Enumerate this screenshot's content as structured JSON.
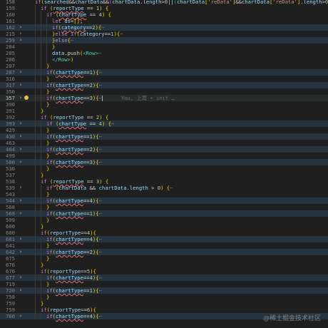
{
  "editor": {
    "lines": [
      {
        "n": "158",
        "fold": "",
        "hl": false,
        "cur": false,
        "bulb": false,
        "indent": 0,
        "code": "if(searched&&chartData&&(chartData.length>0||(chartData['reData']&&chartData['reData'].length>0))){"
      },
      {
        "n": "159",
        "fold": "",
        "hl": false,
        "cur": false,
        "bulb": false,
        "indent": 1,
        "code": "if (reportType == 1) {"
      },
      {
        "n": "160",
        "fold": "",
        "hl": false,
        "cur": false,
        "bulb": false,
        "indent": 2,
        "code": "if (chartType == 4) {"
      },
      {
        "n": "161",
        "fold": "",
        "hl": false,
        "cur": false,
        "bulb": false,
        "indent": 3,
        "code": "let ds=[];"
      },
      {
        "n": "162",
        "fold": "›",
        "hl": true,
        "cur": false,
        "bulb": false,
        "indent": 3,
        "code": "if(category==2){⋯"
      },
      {
        "n": "215",
        "fold": "›",
        "hl": false,
        "cur": false,
        "bulb": false,
        "indent": 3,
        "code": "}else if(category==1){⋯"
      },
      {
        "n": "259",
        "fold": "›",
        "hl": true,
        "cur": false,
        "bulb": false,
        "indent": 3,
        "code": "}else{⋯"
      },
      {
        "n": "284",
        "fold": "",
        "hl": false,
        "cur": false,
        "bulb": false,
        "indent": 3,
        "code": "}"
      },
      {
        "n": "285",
        "fold": "",
        "hl": false,
        "cur": false,
        "bulb": false,
        "indent": 3,
        "code": "data.push(<Row>⋯"
      },
      {
        "n": "286",
        "fold": "",
        "hl": false,
        "cur": false,
        "bulb": false,
        "indent": 3,
        "code": "</Row>)"
      },
      {
        "n": "287",
        "fold": "",
        "hl": false,
        "cur": false,
        "bulb": false,
        "indent": 2,
        "code": "}"
      },
      {
        "n": "287",
        "fold": "›",
        "hl": true,
        "cur": false,
        "bulb": false,
        "indent": 2,
        "code": "if(chartType==1){⋯"
      },
      {
        "n": "316",
        "fold": "",
        "hl": false,
        "cur": false,
        "bulb": false,
        "indent": 2,
        "code": "}"
      },
      {
        "n": "317",
        "fold": "›",
        "hl": true,
        "cur": false,
        "bulb": false,
        "indent": 2,
        "code": "if(chartType==2){⋯"
      },
      {
        "n": "356",
        "fold": "",
        "hl": false,
        "cur": false,
        "bulb": false,
        "indent": 2,
        "code": "}"
      },
      {
        "n": "357",
        "fold": "›",
        "hl": false,
        "cur": true,
        "bulb": true,
        "indent": 2,
        "code": "if(chartType==3){⋯"
      },
      {
        "n": "390",
        "fold": "",
        "hl": false,
        "cur": false,
        "bulb": false,
        "indent": 2,
        "code": "}"
      },
      {
        "n": "391",
        "fold": "",
        "hl": false,
        "cur": false,
        "bulb": false,
        "indent": 1,
        "code": "}"
      },
      {
        "n": "392",
        "fold": "",
        "hl": false,
        "cur": false,
        "bulb": false,
        "indent": 1,
        "code": "if (reportType == 2) {"
      },
      {
        "n": "393",
        "fold": "›",
        "hl": true,
        "cur": false,
        "bulb": false,
        "indent": 2,
        "code": "if (chartType == 4) {⋯"
      },
      {
        "n": "429",
        "fold": "",
        "hl": false,
        "cur": false,
        "bulb": false,
        "indent": 2,
        "code": "}"
      },
      {
        "n": "430",
        "fold": "›",
        "hl": true,
        "cur": false,
        "bulb": false,
        "indent": 2,
        "code": "if(chartType==1){⋯"
      },
      {
        "n": "463",
        "fold": "",
        "hl": false,
        "cur": false,
        "bulb": false,
        "indent": 2,
        "code": "}"
      },
      {
        "n": "464",
        "fold": "›",
        "hl": true,
        "cur": false,
        "bulb": false,
        "indent": 2,
        "code": "if(chartType==2){⋯"
      },
      {
        "n": "499",
        "fold": "",
        "hl": false,
        "cur": false,
        "bulb": false,
        "indent": 2,
        "code": "}"
      },
      {
        "n": "500",
        "fold": "›",
        "hl": true,
        "cur": false,
        "bulb": false,
        "indent": 2,
        "code": "if(chartType==3){⋯"
      },
      {
        "n": "536",
        "fold": "",
        "hl": false,
        "cur": false,
        "bulb": false,
        "indent": 2,
        "code": "}"
      },
      {
        "n": "537",
        "fold": "",
        "hl": false,
        "cur": false,
        "bulb": false,
        "indent": 1,
        "code": "}"
      },
      {
        "n": "538",
        "fold": "",
        "hl": false,
        "cur": false,
        "bulb": false,
        "indent": 1,
        "code": "if (reportType == 3) {"
      },
      {
        "n": "539",
        "fold": "›",
        "hl": false,
        "cur": false,
        "bulb": false,
        "indent": 2,
        "code": "if (chartData && chartData.length > 0) {⋯"
      },
      {
        "n": "543",
        "fold": "",
        "hl": false,
        "cur": false,
        "bulb": false,
        "indent": 2,
        "code": "}"
      },
      {
        "n": "544",
        "fold": "›",
        "hl": true,
        "cur": false,
        "bulb": false,
        "indent": 2,
        "code": "if(chartType==4){⋯"
      },
      {
        "n": "568",
        "fold": "",
        "hl": false,
        "cur": false,
        "bulb": false,
        "indent": 2,
        "code": "}"
      },
      {
        "n": "569",
        "fold": "›",
        "hl": true,
        "cur": false,
        "bulb": false,
        "indent": 2,
        "code": "if(chartType==1){⋯"
      },
      {
        "n": "599",
        "fold": "",
        "hl": false,
        "cur": false,
        "bulb": false,
        "indent": 2,
        "code": "}"
      },
      {
        "n": "600",
        "fold": "",
        "hl": false,
        "cur": false,
        "bulb": false,
        "indent": 1,
        "code": "}"
      },
      {
        "n": "600",
        "fold": "",
        "hl": false,
        "cur": false,
        "bulb": false,
        "indent": 1,
        "code": "if(reportType==4){"
      },
      {
        "n": "601",
        "fold": "›",
        "hl": true,
        "cur": false,
        "bulb": false,
        "indent": 2,
        "code": "if(chartType==4){⋯"
      },
      {
        "n": "641",
        "fold": "",
        "hl": false,
        "cur": false,
        "bulb": false,
        "indent": 2,
        "code": "}"
      },
      {
        "n": "642",
        "fold": "›",
        "hl": true,
        "cur": false,
        "bulb": false,
        "indent": 2,
        "code": "if(chartType==2){⋯"
      },
      {
        "n": "675",
        "fold": "",
        "hl": false,
        "cur": false,
        "bulb": false,
        "indent": 2,
        "code": "}"
      },
      {
        "n": "676",
        "fold": "",
        "hl": false,
        "cur": false,
        "bulb": false,
        "indent": 1,
        "code": "}"
      },
      {
        "n": "676",
        "fold": "",
        "hl": false,
        "cur": false,
        "bulb": false,
        "indent": 1,
        "code": "if(reportType==5){"
      },
      {
        "n": "677",
        "fold": "›",
        "hl": true,
        "cur": false,
        "bulb": false,
        "indent": 2,
        "code": "if(chartType==4){⋯"
      },
      {
        "n": "719",
        "fold": "",
        "hl": false,
        "cur": false,
        "bulb": false,
        "indent": 2,
        "code": "}"
      },
      {
        "n": "720",
        "fold": "›",
        "hl": true,
        "cur": false,
        "bulb": false,
        "indent": 2,
        "code": "if(chartType==1){⋯"
      },
      {
        "n": "758",
        "fold": "",
        "hl": false,
        "cur": false,
        "bulb": false,
        "indent": 2,
        "code": "}"
      },
      {
        "n": "759",
        "fold": "",
        "hl": false,
        "cur": false,
        "bulb": false,
        "indent": 1,
        "code": "}"
      },
      {
        "n": "759",
        "fold": "",
        "hl": false,
        "cur": false,
        "bulb": false,
        "indent": 1,
        "code": "if(reportType==6){"
      },
      {
        "n": "760",
        "fold": "›",
        "hl": true,
        "cur": false,
        "bulb": false,
        "indent": 2,
        "code": "if(chartType==4){⋯"
      }
    ],
    "inline_blame": "You, 上周 • init …",
    "watermark": "@稀土掘金技术社区"
  },
  "theme": {
    "keyword": "#c586c0",
    "variable": "#9cdcfe",
    "string": "#ce9178",
    "number": "#b5cea8",
    "background": "#1f1f1f",
    "highlight": "#26343f"
  }
}
